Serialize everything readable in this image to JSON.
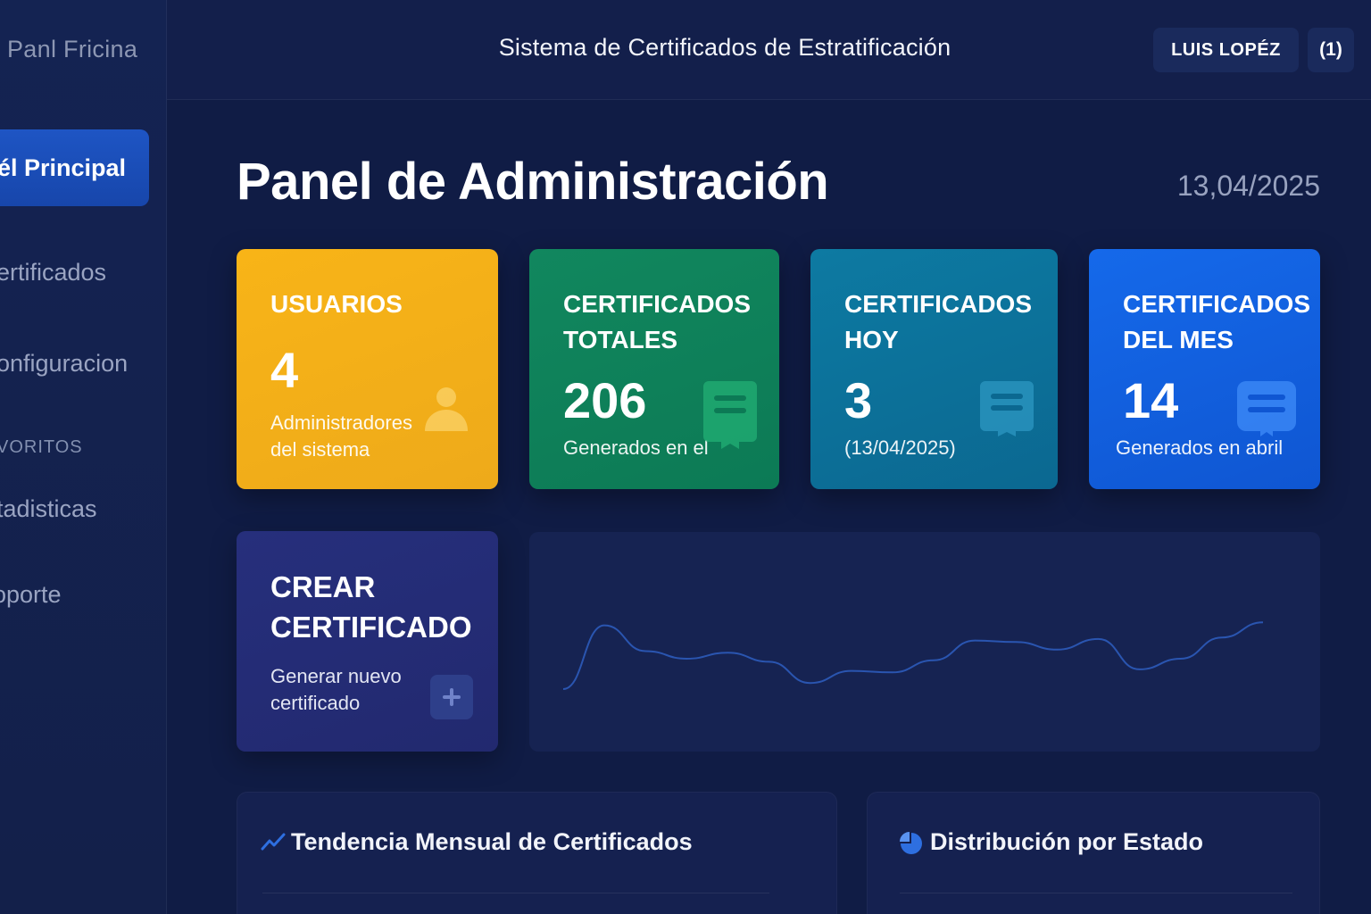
{
  "sidebar": {
    "brand": "Panl Fricina",
    "items": [
      {
        "label": "él Principal",
        "active": true
      },
      {
        "label": "ertificados"
      },
      {
        "label": "onfiguracion"
      },
      {
        "label": "tadisticas"
      },
      {
        "label": "oporte"
      }
    ],
    "section_label": "VORITOS"
  },
  "header": {
    "title": "Sistema de Certificados de Estratificación",
    "user_name": "LUIS LOPÉZ",
    "notifications": "(1)"
  },
  "page": {
    "title": "Panel de Administración",
    "date": "13,04/2025"
  },
  "cards": {
    "users": {
      "label_line1": "USUARIOS",
      "value": "4",
      "sub_line1": "Administradores",
      "sub_line2": "del sistema",
      "icon": "user-icon",
      "color": "#f5b11a"
    },
    "total": {
      "label_line1": "CERTIFICADOS",
      "label_line2": "TOTALES",
      "value": "206",
      "sub": "Generados en el",
      "icon": "certificate-icon",
      "color": "#0f8259"
    },
    "today": {
      "label_line1": "CERTIFICADOS",
      "label_line2": "HOY",
      "value": "3",
      "sub": "(13/04/2025)",
      "icon": "certificate-icon",
      "color": "#0c7199"
    },
    "month": {
      "label_line1": "CERTIFICADOS",
      "label_line2": "DEL MES",
      "value": "14",
      "sub": "Generados en abril",
      "icon": "certificate-icon",
      "color": "#1260de"
    }
  },
  "create": {
    "title_line1": "CREAR",
    "title_line2": "CERTIFICADO",
    "sub_line1": "Generar nuevo",
    "sub_line2": "certificado",
    "icon": "plus-icon"
  },
  "trend_line": {
    "points": [
      0.2,
      0.62,
      0.45,
      0.4,
      0.44,
      0.38,
      0.24,
      0.32,
      0.31,
      0.39,
      0.52,
      0.51,
      0.46,
      0.53,
      0.33,
      0.4,
      0.54,
      0.64
    ],
    "color": "#2a55b0"
  },
  "panels": {
    "trend": {
      "title": "Tendencia Mensual de Certificados",
      "icon": "trend-icon"
    },
    "distribution": {
      "title": "Distribución por Estado",
      "icon": "pie-chart-icon"
    }
  }
}
